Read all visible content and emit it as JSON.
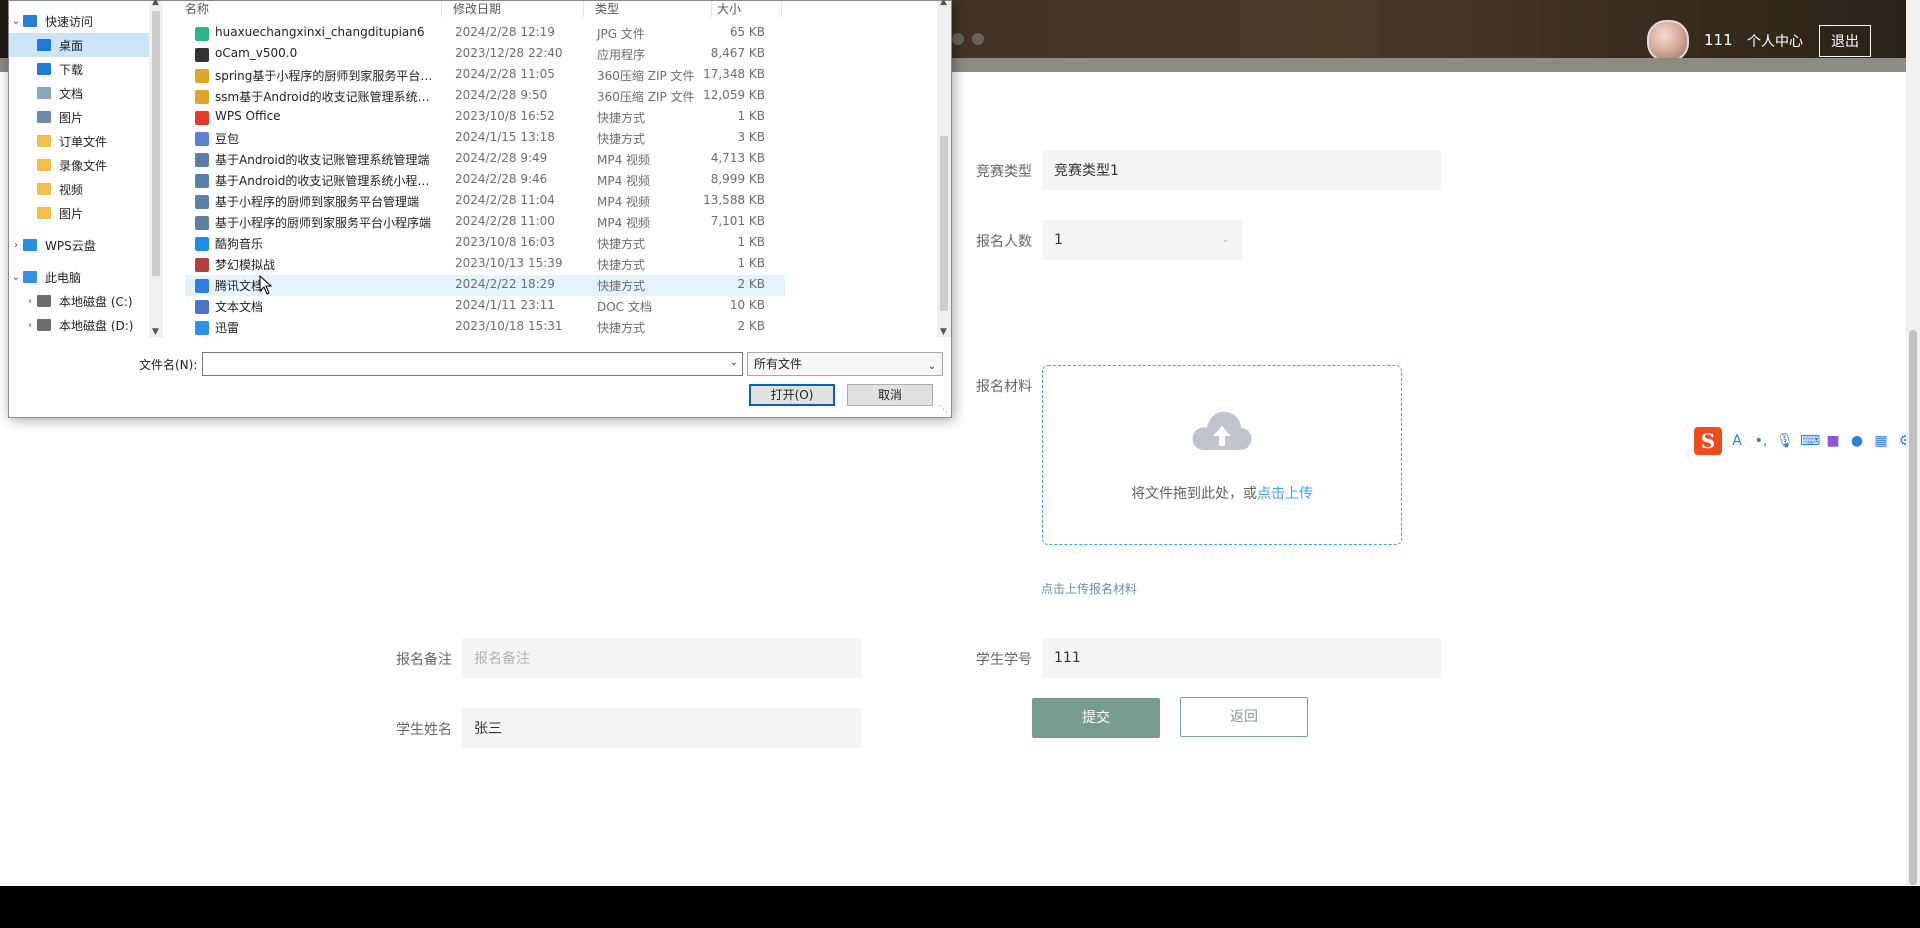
{
  "header": {
    "user_name": "111",
    "profile_link": "个人中心",
    "logout": "退出"
  },
  "form": {
    "competition_type": {
      "label": "竞赛类型",
      "value": "竞赛类型1"
    },
    "participant_count": {
      "label": "报名人数",
      "value": "1"
    },
    "materials": {
      "label": "报名材料",
      "drop_text": "将文件拖到此处，或",
      "drop_link": "点击上传",
      "hint": "点击上传报名材料"
    },
    "remark": {
      "label": "报名备注",
      "placeholder": "报名备注"
    },
    "student_id": {
      "label": "学生学号",
      "value": "111"
    },
    "student_name": {
      "label": "学生姓名",
      "value": "张三"
    },
    "submit": "提交",
    "back": "返回"
  },
  "dialog": {
    "nav": [
      {
        "label": "快速访问",
        "expanded": true,
        "icon": "star-icon",
        "color": "#2b7fd9",
        "indent": 0
      },
      {
        "label": "桌面",
        "selected": true,
        "icon": "desktop-icon",
        "color": "#1f7ad6",
        "indent": 1,
        "pinned": true
      },
      {
        "label": "下载",
        "icon": "download-icon",
        "color": "#1f7ad6",
        "indent": 1,
        "pinned": true
      },
      {
        "label": "文档",
        "icon": "document-icon",
        "color": "#8da3b8",
        "indent": 1,
        "pinned": true
      },
      {
        "label": "图片",
        "icon": "pictures-icon",
        "color": "#6e8aa6",
        "indent": 1,
        "pinned": true
      },
      {
        "label": "订单文件",
        "icon": "folder-icon",
        "color": "#f3c14b",
        "indent": 1
      },
      {
        "label": "录像文件",
        "icon": "folder-icon",
        "color": "#f3c14b",
        "indent": 1
      },
      {
        "label": "视频",
        "icon": "folder-icon",
        "color": "#f3c14b",
        "indent": 1
      },
      {
        "label": "图片",
        "icon": "folder-icon",
        "color": "#f3c14b",
        "indent": 1
      },
      {
        "label": "WPS云盘",
        "collapsed": true,
        "icon": "cloud-icon",
        "color": "#2b8fe0",
        "indent": 0
      },
      {
        "label": "此电脑",
        "expanded": true,
        "icon": "computer-icon",
        "color": "#3a8ee6",
        "indent": 0
      },
      {
        "label": "本地磁盘 (C:)",
        "collapsed": true,
        "icon": "drive-icon",
        "color": "#6d6d6d",
        "indent": 1
      },
      {
        "label": "本地磁盘 (D:)",
        "collapsed": true,
        "icon": "drive-icon",
        "color": "#6d6d6d",
        "indent": 1
      }
    ],
    "columns": {
      "name": "名称",
      "date": "修改日期",
      "type": "类型",
      "size": "大小"
    },
    "files": [
      {
        "name": "huaxuechangxinxi_changditupian6",
        "date": "2024/2/28 12:19",
        "type": "JPG 文件",
        "size": "65 KB",
        "icon": "image-file-icon",
        "color": "#2bb58c"
      },
      {
        "name": "oCam_v500.0",
        "date": "2023/12/28 22:40",
        "type": "应用程序",
        "size": "8,467 KB",
        "icon": "app-icon",
        "color": "#333333"
      },
      {
        "name": "spring基于小程序的厨师到家服务平台演...",
        "date": "2024/2/28 11:05",
        "type": "360压缩 ZIP 文件",
        "size": "17,348 KB",
        "icon": "zip-icon",
        "color": "#e0a62a"
      },
      {
        "name": "ssm基于Android的收支记账管理系统演...",
        "date": "2024/2/28 9:50",
        "type": "360压缩 ZIP 文件",
        "size": "12,059 KB",
        "icon": "zip-icon",
        "color": "#e0a62a"
      },
      {
        "name": "WPS Office",
        "date": "2023/10/8 16:52",
        "type": "快捷方式",
        "size": "1 KB",
        "icon": "wps-icon",
        "color": "#e8392c"
      },
      {
        "name": "豆包",
        "date": "2024/1/15 13:18",
        "type": "快捷方式",
        "size": "3 KB",
        "icon": "doubao-icon",
        "color": "#5a7fd6"
      },
      {
        "name": "基于Android的收支记账管理系统管理端",
        "date": "2024/2/28 9:49",
        "type": "MP4 视频",
        "size": "4,713 KB",
        "icon": "video-icon",
        "color": "#5b7fa8"
      },
      {
        "name": "基于Android的收支记账管理系统小程序...",
        "date": "2024/2/28 9:46",
        "type": "MP4 视频",
        "size": "8,999 KB",
        "icon": "video-icon",
        "color": "#5b7fa8"
      },
      {
        "name": "基于小程序的厨师到家服务平台管理端",
        "date": "2024/2/28 11:04",
        "type": "MP4 视频",
        "size": "13,588 KB",
        "icon": "video-icon",
        "color": "#5b7fa8"
      },
      {
        "name": "基于小程序的厨师到家服务平台小程序端",
        "date": "2024/2/28 11:00",
        "type": "MP4 视频",
        "size": "7,101 KB",
        "icon": "video-icon",
        "color": "#5b7fa8"
      },
      {
        "name": "酷狗音乐",
        "date": "2023/10/8 16:03",
        "type": "快捷方式",
        "size": "1 KB",
        "icon": "kugou-icon",
        "color": "#1f8ce6"
      },
      {
        "name": "梦幻模拟战",
        "date": "2023/10/13 15:39",
        "type": "快捷方式",
        "size": "1 KB",
        "icon": "game-icon",
        "color": "#b0413e"
      },
      {
        "name": "腾讯文档",
        "date": "2024/2/22 18:29",
        "type": "快捷方式",
        "size": "2 KB",
        "icon": "tencent-docs-icon",
        "color": "#2f7de1",
        "highlighted": true
      },
      {
        "name": "文本文档",
        "date": "2024/1/11 23:11",
        "type": "DOC 文档",
        "size": "10 KB",
        "icon": "doc-icon",
        "color": "#4a74c4"
      },
      {
        "name": "迅雷",
        "date": "2023/10/18 15:31",
        "type": "快捷方式",
        "size": "2 KB",
        "icon": "xunlei-icon",
        "color": "#2f8ee8"
      }
    ],
    "filename_label": "文件名(N):",
    "filename_value": "",
    "filter": "所有文件",
    "open": "打开(O)",
    "cancel": "取消"
  }
}
